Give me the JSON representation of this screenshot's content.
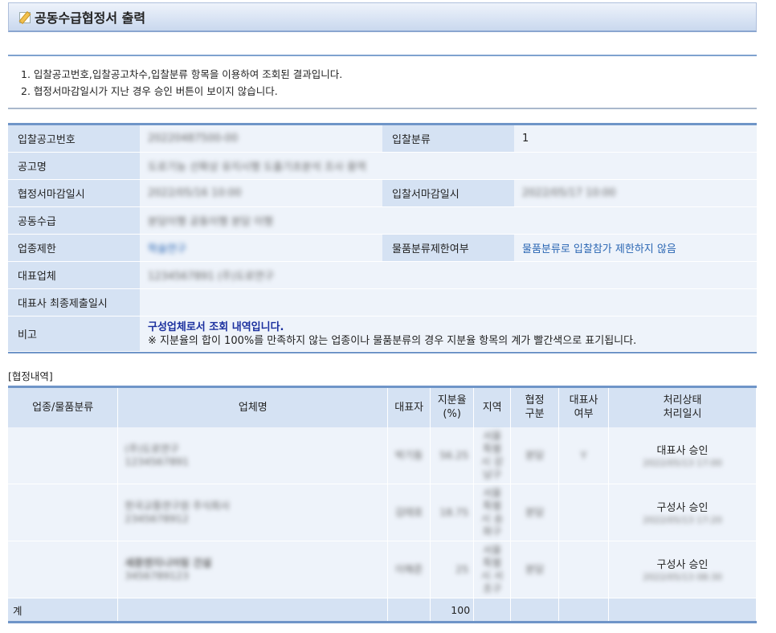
{
  "header": {
    "title": "공동수급협정서 출력",
    "icon": "pencil-note-icon"
  },
  "notice": [
    "1. 입찰공고번호,입찰공고차수,입찰분류 항목을 이용하여 조회된 결과입니다.",
    "2. 협정서마감일시가 지난 경우 승인 버튼이 보이지 않습니다."
  ],
  "info": {
    "bid_no_label": "입찰공고번호",
    "bid_no_value": "20220487500-00",
    "bid_class_label": "입찰분류",
    "bid_class_value": "1",
    "notice_name_label": "공고명",
    "notice_name_value": "도로기능 선확상 유지시행 도출기초분석 조사 용역",
    "agreement_deadline_label": "협정서마감일시",
    "agreement_deadline_value": "2022/05/16 10:00",
    "bid_deadline_label": "입찰서마감일시",
    "bid_deadline_value": "2022/05/17 10:00",
    "joint_label": "공동수급",
    "joint_value": "분담이행 공동이행 분담 이행",
    "industry_label": "업종제한",
    "industry_value": "학술연구",
    "goods_label": "물품분류제한여부",
    "goods_value": "물품분류로 입찰참가 제한하지 않음",
    "rep_label": "대표업체",
    "rep_value": "1234567891 (주)도로연구",
    "rep_submit_label": "대표사 최종제출일시",
    "rep_submit_value": "",
    "remark_label": "비고",
    "remark_line1": "구성업체로서 조회 내역입니다.",
    "remark_line2": "※ 지분율의 합이 100%를 만족하지 않는 업종이나 물품분류의 경우 지분율 항목의 계가 빨간색으로 표기됩니다."
  },
  "agreement": {
    "section_title": "[협정내역]",
    "columns": [
      "업종/물품분류",
      "업체명",
      "대표자",
      "지분율\n(%)",
      "지역",
      "협정\n구분",
      "대표사\n여부",
      "처리상태\n처리일시"
    ],
    "rows": [
      {
        "company": "(주)도로연구",
        "bizno": "1234567891",
        "ceo": "박기동",
        "share": "56.25",
        "region": "서울특별시 강남구",
        "type": "분담",
        "is_rep": "Y",
        "status": "대표사 승인",
        "date": "2022/05/13 17:00"
      },
      {
        "company": "한국교통연구원 주식회사",
        "bizno": "2345678912",
        "ceo": "김태호",
        "share": "18.75",
        "region": "서울특별시 송파구",
        "type": "분담",
        "is_rep": "",
        "status": "구성사 승인",
        "date": "2022/05/13 17:20"
      },
      {
        "company": "세종엔지니어링 건설",
        "bizno": "3456789123",
        "ceo": "이해준",
        "share": "25",
        "region": "서울특별시 서초구",
        "type": "분담",
        "is_rep": "",
        "status": "구성사 승인",
        "date": "2022/05/13 08:30"
      }
    ],
    "total_label": "계",
    "total_value": "100"
  }
}
